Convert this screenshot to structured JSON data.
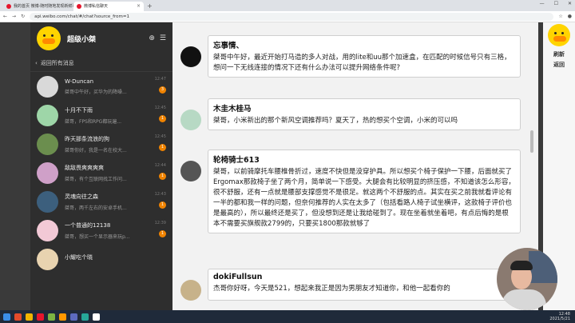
{
  "browser": {
    "tabs": [
      {
        "label": "我的首页 微博-随时随地发现新鲜事"
      },
      {
        "label": "微博私信聊天"
      }
    ],
    "url": "api.weibo.com/chat/#/chat?source_from=1"
  },
  "sidebar": {
    "title": "超级小桀",
    "back_label": "返回所有消息",
    "conversations": [
      {
        "name": "W-Duncan",
        "snippet": "桀哥中午好，买华为的降噪...",
        "time": "12:47",
        "badge": "3",
        "color": "#d9d9d9"
      },
      {
        "name": "十月不下雨",
        "snippet": "桀哥，FPS和RPG都玩遍...",
        "time": "12:45",
        "badge": "1",
        "color": "#9ed6a8"
      },
      {
        "name": "昨天那条流浪的狗",
        "snippet": "桀哥你好，我是一名在校大...",
        "time": "12:45",
        "badge": "1",
        "color": "#6b8e4e"
      },
      {
        "name": "敌敌畏爽爽爽爽",
        "snippet": "桀哥，有个互联网找工作问...",
        "time": "12:44",
        "badge": "1",
        "color": "#cfa0c8"
      },
      {
        "name": "灵魂向往之森",
        "snippet": "桀哥，两千左右的安卓手机...",
        "time": "12:43",
        "badge": "1",
        "color": "#3c5f7d"
      },
      {
        "name": "一个普通的12138",
        "snippet": "桀哥，想买一个显示器来玩p...",
        "time": "12:39",
        "badge": "1",
        "color": "#f2c9d6"
      },
      {
        "name": "小耀吃个晓",
        "snippet": "",
        "time": "",
        "badge": "",
        "color": "#e8d3b0"
      }
    ]
  },
  "messages": [
    {
      "name": "忘事情、",
      "text": "桀哥中午好，最近开始打马造的多人对战，用的lite和uu那个加速盒，在匹配的时候信号只有三格，想问一下无线连接的情况下还有什么办法可以提升网络条件呢?",
      "color": "#111"
    },
    {
      "name": "木圭木桂马",
      "text": "桀哥，小米新出的那个新风空调推荐吗？夏天了，热的想买个空调，小米的可以吗",
      "color": "#b7d9c4"
    },
    {
      "name": "轮椅骑士613",
      "text": "桀哥，以前骑摩托车腰椎骨折过，速度不快但是没穿护具。所以想买个椅子保护一下腰，后面就买了Ergomax那款椅子坐了两个月，简单说一下感受。大腿会有比较明显的挤压感，不知道该怎么形容，很不舒服，还有一点就是腰部支撑感觉不是很足。就这两个不舒服的点。其实在买之前我就看评论有一半的都和我一样的问题，但奈何推荐的人实在太多了（包括看路人椅子试坐横评，这款椅子评价也是最高的），所以最终还是买了，但没想到还是让我给碰到了。现在坐着就坐着吧，有点后悔的是根本不需要买旗舰款2799的，只要买1800那款就够了",
      "color": "#555"
    },
    {
      "name": "dokiFullsun",
      "text": "杰哥你好呀，今天是521，想起来我正是因为男朋友才知道你，和他一起看你的",
      "color": "#c7b28a"
    }
  ],
  "rightbar": {
    "refresh": "刷新",
    "back": "返回"
  },
  "taskbar": {
    "time": "12:48",
    "date": "2021/5/21"
  }
}
